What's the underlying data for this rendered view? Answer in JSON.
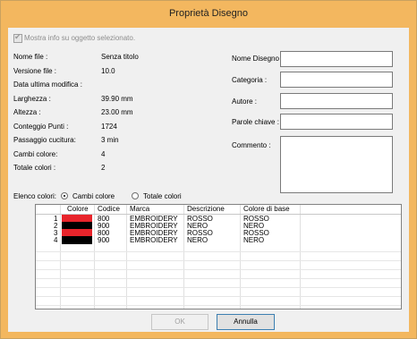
{
  "window": {
    "title": "Proprietà Disegno"
  },
  "show_info": {
    "label": "Mostra info su oggetto selezionato.",
    "checked": true
  },
  "info_rows": [
    {
      "label": "Nome file :",
      "value": "Senza titolo"
    },
    {
      "label": "Versione file :",
      "value": "10.0"
    },
    {
      "label": "Data ultima modifica :",
      "value": ""
    },
    {
      "label": "Larghezza :",
      "value": "39.90 mm"
    },
    {
      "label": "Altezza :",
      "value": "23.00 mm"
    },
    {
      "label": "Conteggio Punti :",
      "value": "1724"
    },
    {
      "label": "Passaggio cucitura:",
      "value": "3 min"
    },
    {
      "label": "Cambi colore:",
      "value": "4"
    },
    {
      "label": "Totale colori :",
      "value": "2"
    }
  ],
  "fields": {
    "nome_label": "Nome Disegno :",
    "nome_value": "",
    "categoria_label": "Categoria :",
    "categoria_value": "",
    "autore_label": "Autore :",
    "autore_value": "",
    "parole_label": "Parole chiave :",
    "parole_value": "",
    "commento_label": "Commento :",
    "commento_value": ""
  },
  "color_list": {
    "label": "Elenco colori:",
    "option_changes": "Cambi colore",
    "option_total": "Totale colori",
    "selected": "Cambi colore"
  },
  "table": {
    "columns": [
      "Colore",
      "Codice",
      "Marca",
      "Descrizione",
      "Colore di base"
    ],
    "rows": [
      {
        "num": "1",
        "color": "#e8242b",
        "code": "800",
        "brand": "EMBROIDERY",
        "desc": "ROSSO",
        "base": "ROSSO"
      },
      {
        "num": "2",
        "color": "#000000",
        "code": "900",
        "brand": "EMBROIDERY",
        "desc": "NERO",
        "base": "NERO"
      },
      {
        "num": "3",
        "color": "#e8242b",
        "code": "800",
        "brand": "EMBROIDERY",
        "desc": "ROSSO",
        "base": "ROSSO"
      },
      {
        "num": "4",
        "color": "#000000",
        "code": "900",
        "brand": "EMBROIDERY",
        "desc": "NERO",
        "base": "NERO"
      }
    ]
  },
  "buttons": {
    "ok": "OK",
    "cancel": "Annulla"
  }
}
